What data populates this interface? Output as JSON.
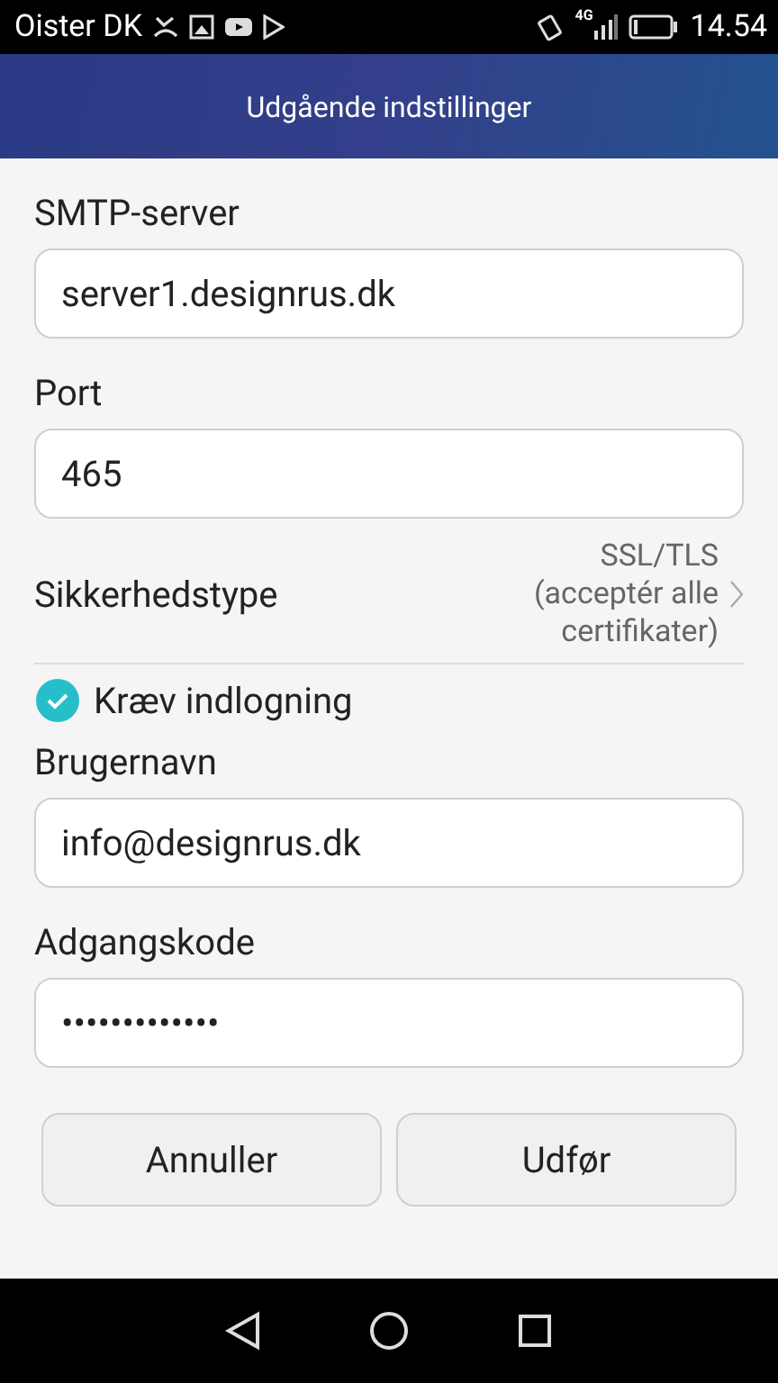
{
  "status_bar": {
    "carrier": "Oister DK",
    "network": "4G",
    "time": "14.54"
  },
  "title_bar": {
    "title": "Udgående indstillinger"
  },
  "fields": [
    {
      "label": "SMTP-server",
      "value": "server1.designrus.dk"
    },
    {
      "label": "Port",
      "value": "465"
    }
  ],
  "security": {
    "label": "Sikkerhedstype",
    "value": "SSL/TLS\n(acceptér alle\ncertifikater)"
  },
  "login": {
    "label": "Kræv indlogning",
    "checked": true
  },
  "login_fields": [
    {
      "label": "Brugernavn",
      "value": "info@designrus.dk"
    },
    {
      "label": "Adgangskode",
      "value": "•••••••••••••"
    }
  ],
  "buttons": [
    "Annuller",
    "Udfør"
  ]
}
